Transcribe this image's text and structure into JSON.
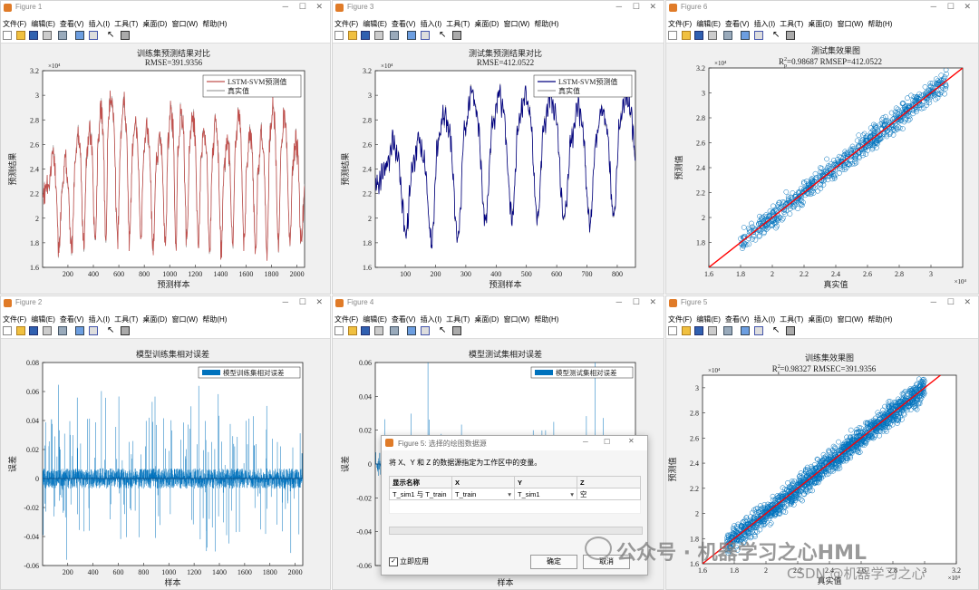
{
  "menus": [
    "文件(F)",
    "编辑(E)",
    "查看(V)",
    "插入(I)",
    "工具(T)",
    "桌面(D)",
    "窗口(W)",
    "帮助(H)"
  ],
  "colors": {
    "red": "#c0504d",
    "blue": "#0072bd",
    "navy": "#00007f",
    "fitline": "#ff0000"
  },
  "figures": [
    {
      "id": "f1",
      "window_title": "Figure 1",
      "title1": "训练集预测结果对比",
      "title2": "RMSE=391.9356",
      "xlabel": "预测样本",
      "ylabel": "预测结果",
      "exp": "×10⁴",
      "legend": [
        "LSTM-SVM预测值",
        "真实值"
      ],
      "xticks": [
        "200",
        "400",
        "600",
        "800",
        "1000",
        "1200",
        "1400",
        "1600",
        "1800",
        "2000"
      ],
      "yticks": [
        "1.6",
        "1.8",
        "2",
        "2.2",
        "2.4",
        "2.6",
        "2.8",
        "3",
        "3.2"
      ]
    },
    {
      "id": "f3",
      "window_title": "Figure 3",
      "title1": "测试集预测结果对比",
      "title2": "RMSE=412.0522",
      "xlabel": "预测样本",
      "ylabel": "预测结果",
      "exp": "×10⁴",
      "legend": [
        "LSTM-SVM预测值",
        "真实值"
      ],
      "xticks": [
        "100",
        "200",
        "300",
        "400",
        "500",
        "600",
        "700",
        "800"
      ],
      "yticks": [
        "1.6",
        "1.8",
        "2",
        "2.2",
        "2.4",
        "2.6",
        "2.8",
        "3",
        "3.2"
      ]
    },
    {
      "id": "f6",
      "window_title": "Figure 6",
      "title1": "测试集效果图",
      "title2a": "R",
      "title2sup": "2",
      "title2sub": "p",
      "title2b": "=0.98687  RMSEP=412.0522",
      "xlabel": "真实值",
      "ylabel": "预测值",
      "exp": "×10⁴",
      "xticks": [
        "1.6",
        "1.8",
        "2",
        "2.2",
        "2.4",
        "2.6",
        "2.8",
        "3"
      ],
      "yticks": [
        "1.8",
        "2",
        "2.2",
        "2.4",
        "2.6",
        "2.8",
        "3",
        "3.2"
      ]
    },
    {
      "id": "f2",
      "window_title": "Figure 2",
      "title1": "模型训练集相对误差",
      "xlabel": "样本",
      "ylabel": "误差",
      "legend": [
        "模型训练集相对误差"
      ],
      "xticks": [
        "200",
        "400",
        "600",
        "800",
        "1000",
        "1200",
        "1400",
        "1600",
        "1800",
        "2000"
      ],
      "yticks": [
        "-0.06",
        "-0.04",
        "-0.02",
        "0",
        "0.02",
        "0.04",
        "0.06",
        "0.08"
      ]
    },
    {
      "id": "f4",
      "window_title": "Figure 4",
      "title1": "模型测试集相对误差",
      "xlabel": "样本",
      "ylabel": "误差",
      "legend": [
        "模型测试集相对误差"
      ],
      "yticks": [
        "-0.06",
        "-0.04",
        "-0.02",
        "0",
        "0.02",
        "0.04",
        "0.06"
      ]
    },
    {
      "id": "f5",
      "window_title": "Figure 5",
      "title1": "训练集效果图",
      "title2a": "R",
      "title2sup": "2",
      "title2sub": "c",
      "title2b": "=0.98327  RMSEC=391.9356",
      "xlabel": "真实值",
      "ylabel": "预测值",
      "exp": "×10⁴",
      "xticks": [
        "1.6",
        "1.8",
        "2",
        "2.2",
        "2.4",
        "2.6",
        "2.8",
        "3",
        "3.2"
      ],
      "yticks": [
        "1.6",
        "1.8",
        "2",
        "2.2",
        "2.4",
        "2.6",
        "2.8",
        "3"
      ]
    }
  ],
  "dialog": {
    "title": "Figure 5: 选择的绘图数据源",
    "desc": "将 X、Y 和 Z 的数据源指定为工作区中的变量。",
    "headers": [
      "显示名称",
      "X",
      "Y",
      "Z"
    ],
    "row": [
      "T_sim1 与 T_train",
      "T_train",
      "T_sim1",
      "空"
    ],
    "checkbox": "立即应用",
    "ok": "确定",
    "cancel": "取消"
  },
  "watermark": {
    "line1": "公众号 · 机器学习之心HML",
    "line2": "CSDN @机器学习之心"
  },
  "chart_data": [
    {
      "type": "line",
      "title": "训练集预测结果对比",
      "subtitle": "RMSE=391.9356",
      "xlabel": "预测样本",
      "ylabel": "预测结果",
      "xlim": [
        1,
        2060
      ],
      "ylim": [
        16000,
        32000
      ],
      "series": [
        {
          "name": "LSTM-SVM预测值",
          "peaks_x": [
            80,
            180,
            280,
            370,
            460,
            540,
            640,
            730,
            820,
            920,
            1010,
            1090,
            1180,
            1270,
            1360,
            1450,
            1540,
            1630,
            1720,
            1810,
            1900,
            1990
          ],
          "peaks": [
            25500,
            24800,
            27000,
            27500,
            29000,
            30000,
            29500,
            28000,
            27500,
            27000,
            29000,
            28500,
            28500,
            27500,
            28000,
            26500,
            28500,
            27000,
            27000,
            29000,
            28500,
            26500
          ],
          "troughs": [
            17500,
            17500,
            18000,
            18000,
            18000,
            18500,
            18000,
            18000,
            18000,
            17800,
            18000,
            18000,
            18000,
            17500,
            17500,
            17800,
            18000,
            17500,
            17500,
            18000,
            17800,
            18000
          ]
        },
        {
          "name": "真实值"
        }
      ]
    },
    {
      "type": "line",
      "title": "测试集预测结果对比",
      "subtitle": "RMSE=412.0522",
      "xlabel": "预测样本",
      "ylabel": "预测结果",
      "xlim": [
        1,
        860
      ],
      "ylim": [
        16000,
        32000
      ],
      "series": [
        {
          "name": "LSTM-SVM预测值",
          "peaks_x": [
            60,
            145,
            230,
            320,
            410,
            495,
            580,
            670,
            750,
            830
          ],
          "peaks": [
            26500,
            26500,
            28500,
            30000,
            30000,
            30000,
            30000,
            29000,
            29000,
            30000
          ],
          "troughs": [
            19000,
            18000,
            18500,
            20000,
            20000,
            20000,
            20000,
            19500,
            20000,
            20000
          ]
        },
        {
          "name": "真实值"
        }
      ]
    },
    {
      "type": "scatter",
      "title": "测试集效果图",
      "subtitle": "R²p=0.98687  RMSEP=412.0522",
      "xlabel": "真实值",
      "ylabel": "预测值",
      "xlim": [
        16000,
        32000
      ],
      "ylim": [
        16000,
        32000
      ],
      "x_range": [
        18000,
        31000
      ],
      "r2": 0.98687,
      "fit": "y=x"
    },
    {
      "type": "bar",
      "title": "模型训练集相对误差",
      "xlabel": "样本",
      "ylabel": "误差",
      "xlim": [
        1,
        2060
      ],
      "ylim": [
        -0.06,
        0.08
      ],
      "n": 2060,
      "amplitude": 0.07
    },
    {
      "type": "bar",
      "title": "模型测试集相对误差",
      "xlabel": "样本",
      "ylabel": "误差",
      "ylim": [
        -0.06,
        0.06
      ],
      "n": 860,
      "amplitude": 0.05
    },
    {
      "type": "scatter",
      "title": "训练集效果图",
      "subtitle": "R²c=0.98327  RMSEC=391.9356",
      "xlabel": "真实值",
      "ylabel": "预测值",
      "xlim": [
        16000,
        32000
      ],
      "ylim": [
        16000,
        31000
      ],
      "x_range": [
        17500,
        30000
      ],
      "r2": 0.98327,
      "fit": "y=x"
    }
  ]
}
